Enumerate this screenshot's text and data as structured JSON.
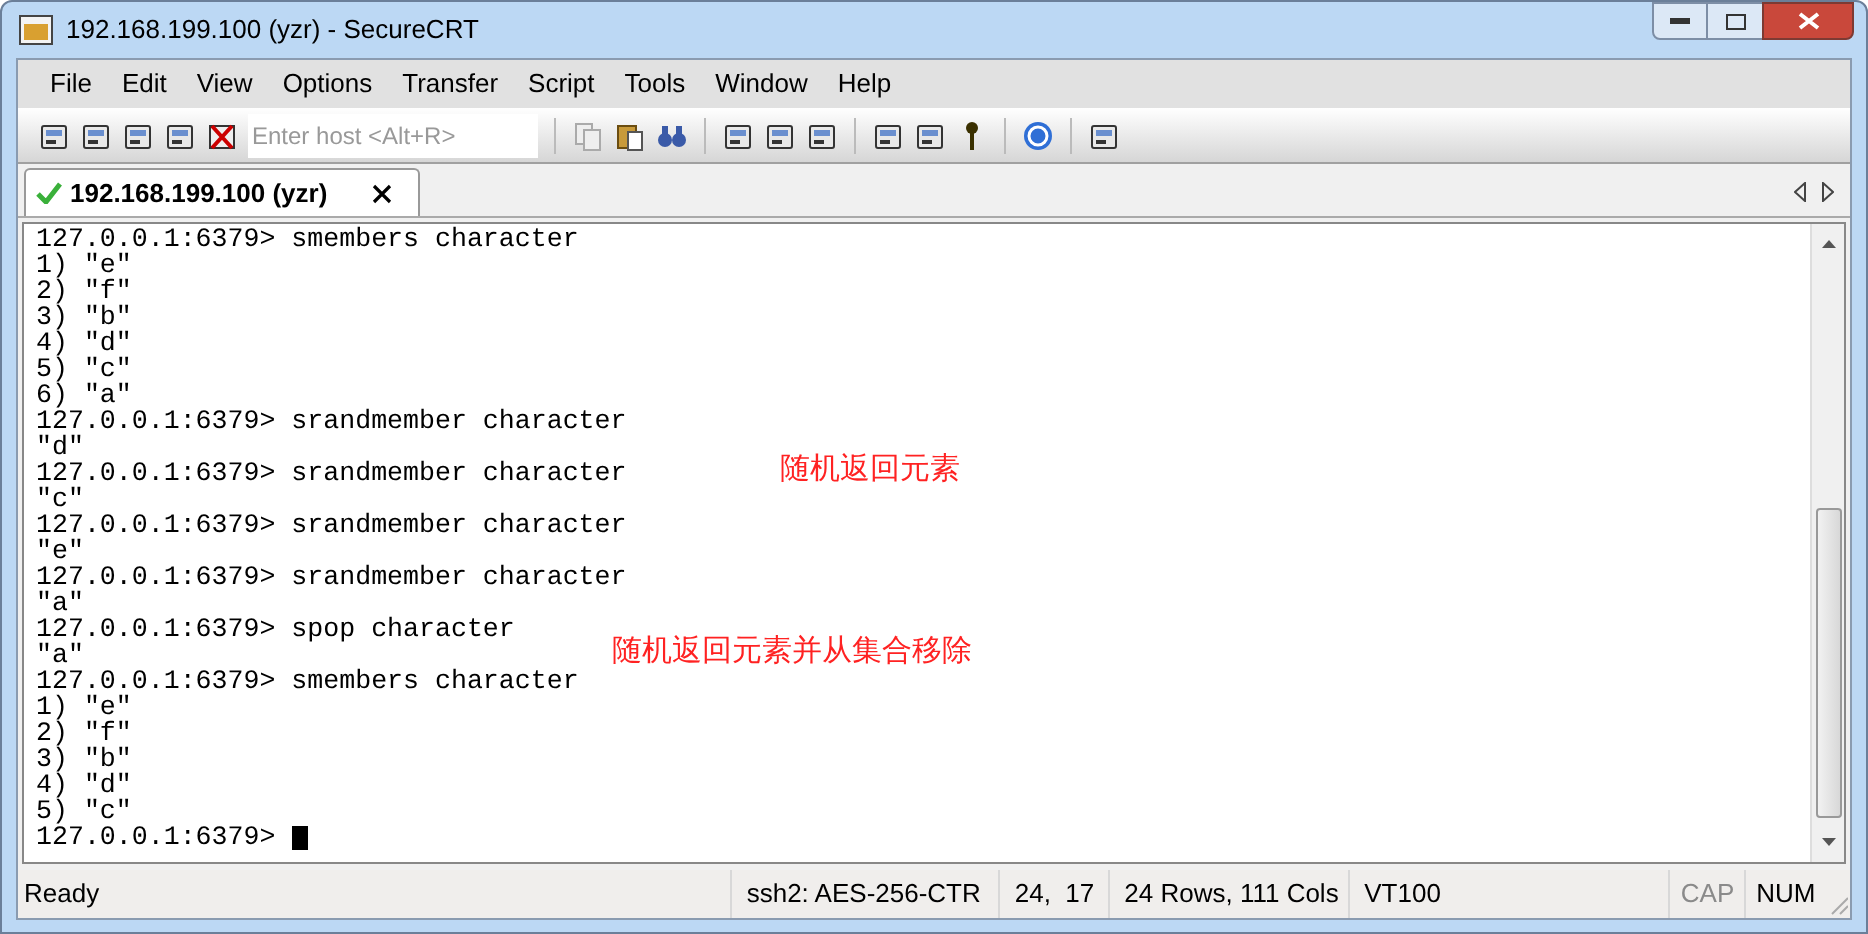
{
  "window": {
    "title": "192.168.199.100 (yzr) - SecureCRT"
  },
  "menu": [
    "File",
    "Edit",
    "View",
    "Options",
    "Transfer",
    "Script",
    "Tools",
    "Window",
    "Help"
  ],
  "toolbar": {
    "host_field": {
      "placeholder": "Enter host <Alt+R>"
    }
  },
  "tabs": [
    {
      "label": "192.168.199.100 (yzr)",
      "selected": true,
      "connected": true
    }
  ],
  "terminal": {
    "lines": [
      {
        "text": "127.0.0.1:6379> smembers character"
      },
      {
        "text": "1) \"e\""
      },
      {
        "text": "2) \"f\""
      },
      {
        "text": "3) \"b\""
      },
      {
        "text": "4) \"d\""
      },
      {
        "text": "5) \"c\""
      },
      {
        "text": "6) \"a\""
      },
      {
        "text": "127.0.0.1:6379> srandmember character"
      },
      {
        "text": "\"d\""
      },
      {
        "text": "127.0.0.1:6379> srandmember character",
        "note": "随机返回元素"
      },
      {
        "text": "\"c\""
      },
      {
        "text": "127.0.0.1:6379> srandmember character"
      },
      {
        "text": "\"e\""
      },
      {
        "text": "127.0.0.1:6379> srandmember character"
      },
      {
        "text": "\"a\""
      },
      {
        "text": "127.0.0.1:6379> spop character"
      },
      {
        "text": "\"a\"",
        "note": "随机返回元素并从集合移除"
      },
      {
        "text": "127.0.0.1:6379> smembers character"
      },
      {
        "text": "1) \"e\""
      },
      {
        "text": "2) \"f\""
      },
      {
        "text": "3) \"b\""
      },
      {
        "text": "4) \"d\""
      },
      {
        "text": "5) \"c\""
      },
      {
        "text": "127.0.0.1:6379> ",
        "cursor": true
      }
    ]
  },
  "status_bar": {
    "message": "Ready",
    "panes": [
      "ssh2: AES-256-CTR",
      "24,  17",
      "24 Rows, 111 Cols",
      "VT100"
    ],
    "indicators": [
      {
        "label": "CAP",
        "on": false
      },
      {
        "label": "NUM",
        "on": true
      }
    ]
  }
}
